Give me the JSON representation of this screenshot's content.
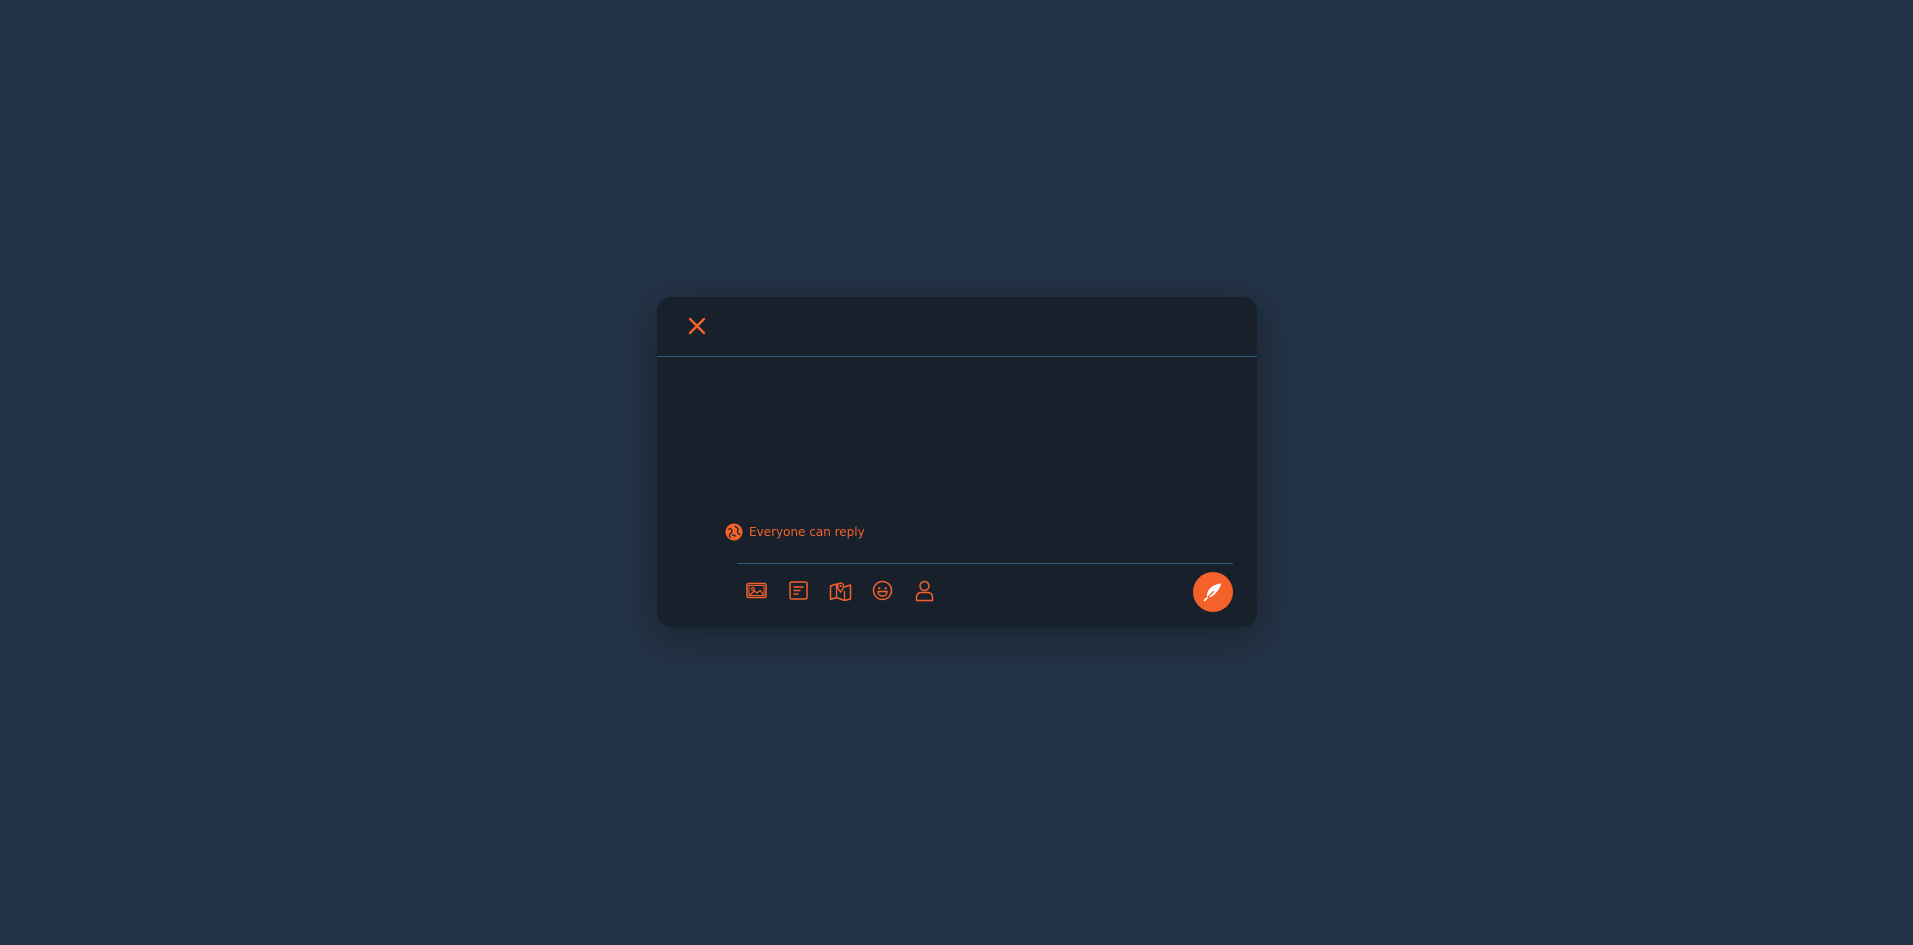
{
  "modal": {
    "close_icon": "close-icon",
    "compose": {
      "value": "",
      "placeholder": ""
    },
    "reply_setting": {
      "icon": "globe-icon",
      "label": "Everyone can reply"
    },
    "toolbar": {
      "items": [
        {
          "icon": "image-icon"
        },
        {
          "icon": "poll-icon"
        },
        {
          "icon": "map-icon"
        },
        {
          "icon": "emoji-icon"
        },
        {
          "icon": "user-icon"
        }
      ]
    },
    "send_icon": "feather-icon"
  },
  "colors": {
    "background": "#233346",
    "panel": "#18202c",
    "accent": "#f4622a",
    "divider": "#2b5a7a"
  }
}
